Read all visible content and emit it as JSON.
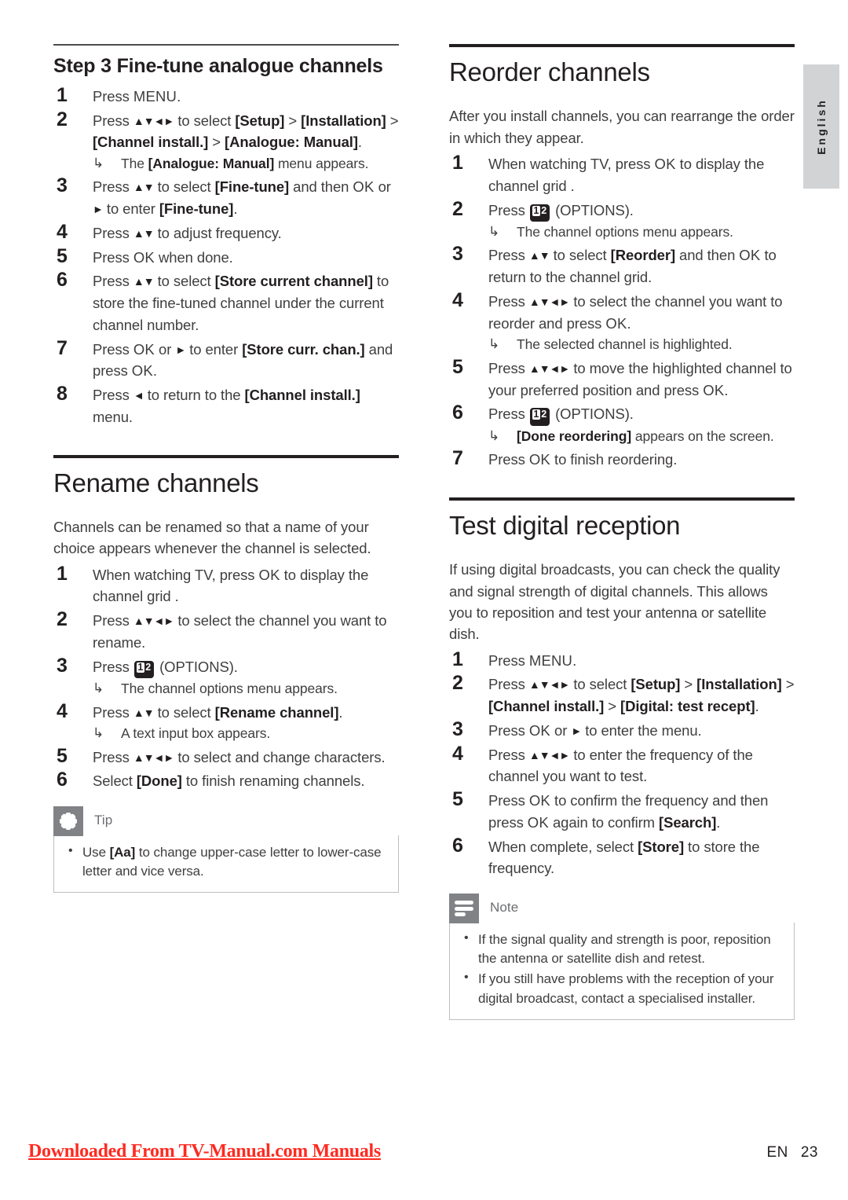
{
  "page": {
    "language_tab": "English",
    "footer_link": "Downloaded From TV-Manual.com Manuals",
    "footer_lang": "EN",
    "footer_page": "23"
  },
  "left_column": {
    "step3": {
      "title_prefix": "Step 3",
      "title": "Fine-tune analogue channels",
      "steps": [
        {
          "num": "1",
          "text": "Press MENU."
        },
        {
          "num": "2",
          "text": "Press ▲▼◄► to select [Setup] > [Installation] > [Channel install.] > [Analogue: Manual].",
          "sub": "The [Analogue: Manual] menu appears."
        },
        {
          "num": "3",
          "text": "Press ▲▼ to select [Fine-tune] and then OK or ► to enter [Fine-tune]."
        },
        {
          "num": "4",
          "text": "Press ▲▼ to adjust frequency."
        },
        {
          "num": "5",
          "text": "Press OK when done."
        },
        {
          "num": "6",
          "text": "Press ▲▼ to select [Store current channel] to store the fine-tuned channel under the current channel number."
        },
        {
          "num": "7",
          "text": "Press OK or ► to enter [Store curr. chan.] and press OK."
        },
        {
          "num": "8",
          "text": "Press ◄ to return to the [Channel install.] menu."
        }
      ]
    },
    "rename": {
      "title": "Rename channels",
      "intro": "Channels can be renamed so that a name of your choice appears whenever the channel is selected.",
      "steps": [
        {
          "num": "1",
          "text": "When watching TV, press OK to display the channel grid ."
        },
        {
          "num": "2",
          "text": "Press ▲▼◄► to select the channel you want to rename."
        },
        {
          "num": "3",
          "text": "Press ①② (OPTIONS).",
          "sub": "The channel options menu appears."
        },
        {
          "num": "4",
          "text": "Press ▲▼ to select [Rename channel].",
          "sub": "A text input box appears."
        },
        {
          "num": "5",
          "text": "Press ▲▼◄► to select and change characters."
        },
        {
          "num": "6",
          "text": "Select [Done] to finish renaming channels."
        }
      ]
    },
    "tip": {
      "icon": "starburst-icon",
      "label": "Tip",
      "items": [
        "Use [Aa] to change upper-case letter to lower-case letter and vice versa."
      ]
    }
  },
  "right_column": {
    "reorder": {
      "title": "Reorder channels",
      "intro": "After you install channels, you can rearrange the order in which they appear.",
      "steps": [
        {
          "num": "1",
          "text": "When watching TV, press OK to display the channel grid ."
        },
        {
          "num": "2",
          "text": "Press ①② (OPTIONS).",
          "sub": "The channel options menu appears."
        },
        {
          "num": "3",
          "text": "Press ▲▼ to select [Reorder] and then OK to return to the channel grid."
        },
        {
          "num": "4",
          "text": "Press ▲▼◄► to select the channel you want to reorder and press OK.",
          "sub": "The selected channel is highlighted."
        },
        {
          "num": "5",
          "text": "Press ▲▼◄► to move the highlighted channel to your preferred position and press OK."
        },
        {
          "num": "6",
          "text": "Press ①② (OPTIONS).",
          "sub": "[Done reordering] appears on the screen."
        },
        {
          "num": "7",
          "text": "Press OK to finish reordering."
        }
      ]
    },
    "test": {
      "title": "Test digital reception",
      "intro": "If using digital broadcasts, you can check the quality and signal strength of digital channels. This allows you to reposition and test your antenna or satellite dish.",
      "steps": [
        {
          "num": "1",
          "text": "Press MENU."
        },
        {
          "num": "2",
          "text": "Press ▲▼◄► to select [Setup] > [Installation] > [Channel install.] > [Digital: test recept]."
        },
        {
          "num": "3",
          "text": "Press OK or ► to enter the menu."
        },
        {
          "num": "4",
          "text": "Press ▲▼◄► to enter the frequency of the channel you want to test."
        },
        {
          "num": "5",
          "text": "Press OK to confirm the frequency and then press OK again to confirm [Search]."
        },
        {
          "num": "6",
          "text": "When complete, select [Store] to store the frequency."
        }
      ]
    },
    "note": {
      "icon": "note-lines-icon",
      "label": "Note",
      "items": [
        "If the signal quality and strength is poor, reposition the antenna or satellite dish and retest.",
        "If you still have problems with the reception of your digital broadcast, contact a specialised installer."
      ]
    }
  },
  "colors": {
    "text": "#403e3f",
    "heading": "#231f20",
    "callout_badge": "#808285",
    "callout_border": "#bcbec0",
    "lang_tab": "#d1d3d4",
    "footer_link": "#ff2a20"
  }
}
